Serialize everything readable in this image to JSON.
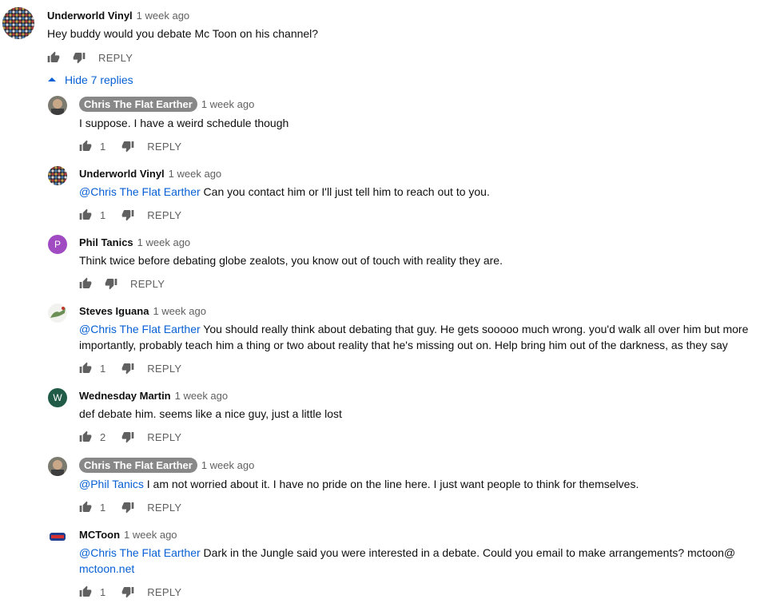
{
  "top_comment": {
    "author": "Underworld Vinyl",
    "time": "1 week ago",
    "text": "Hey buddy would you debate Mc Toon on his channel?",
    "reply_label": "REPLY"
  },
  "replies_toggle": {
    "label": "Hide 7 replies"
  },
  "replies": [
    {
      "author": "Chris The Flat Earther",
      "time": "1 week ago",
      "mention": "",
      "lines": [
        "I suppose. I have a weird schedule though"
      ],
      "likes": "1",
      "reply_label": "REPLY"
    },
    {
      "author": "Underworld Vinyl",
      "time": "1 week ago",
      "mention": "@Chris The Flat Earther",
      "lines": [
        " Can you contact him or I'll just tell him to reach out to you."
      ],
      "likes": "1",
      "reply_label": "REPLY"
    },
    {
      "author": "Phil Tanics",
      "time": "1 week ago",
      "avatar_letter": "P",
      "mention": "",
      "lines": [
        "Think twice before debating globe zealots, you know out of touch with reality they are."
      ],
      "likes": "",
      "reply_label": "REPLY"
    },
    {
      "author": "Steves Iguana",
      "time": "1 week ago",
      "mention": "@Chris The Flat Earther",
      "lines": [
        " You should really think about debating that guy. He gets sooooo much wrong. you'd walk all over him but more",
        "importantly, probably teach him a thing or two about reality that he's missing out on. Help bring him out of the darkness, as they say"
      ],
      "likes": "1",
      "reply_label": "REPLY"
    },
    {
      "author": "Wednesday Martin",
      "time": "1 week ago",
      "avatar_letter": "W",
      "mention": "",
      "lines": [
        "def debate him. seems like a nice guy, just a little lost"
      ],
      "likes": "2",
      "reply_label": "REPLY"
    },
    {
      "author": "Chris The Flat Earther",
      "time": "1 week ago",
      "mention": "@Phil Tanics",
      "lines": [
        " I am not worried about it.  I have no pride on the line here. I just want people to think for themselves."
      ],
      "likes": "1",
      "reply_label": "REPLY"
    },
    {
      "author": "MCToon",
      "time": "1 week ago",
      "mention": "@Chris The Flat Earther",
      "lines": [
        " Dark in the Jungle said you were interested in a debate.  Could you email to make arrangements?  mctoon@"
      ],
      "link_line": "mctoon.net",
      "likes": "1",
      "reply_label": "REPLY"
    }
  ],
  "colors": {
    "link": "#065fd4",
    "secondary_text": "#606060",
    "owner_badge": "#888888",
    "avatar_phil": "#a14bc2",
    "avatar_wednesday": "#1f5b47"
  },
  "icons": [
    "thumb-up-icon",
    "thumb-down-icon",
    "chevron-up-icon"
  ]
}
